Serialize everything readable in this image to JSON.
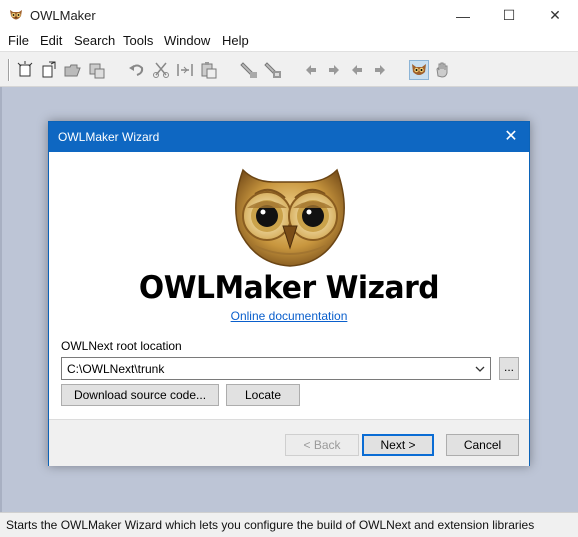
{
  "app": {
    "title": "OWLMaker",
    "window_controls": {
      "minimize": "—",
      "maximize": "☐",
      "close": "✕"
    }
  },
  "menu": [
    "File",
    "Edit",
    "Search",
    "Tools",
    "Window",
    "Help"
  ],
  "toolbar": {
    "groups": [
      [
        "new-wizard-icon",
        "new-file-icon",
        "open-folder-icon",
        "save-icon"
      ],
      [
        "undo-icon",
        "cut-icon",
        "split-icon",
        "paste-icon"
      ],
      [
        "build-icon",
        "build-all-icon"
      ],
      [
        "arrow-left-icon",
        "arrow-right-icon",
        "arrow-left-alt-icon",
        "arrow-right-alt-icon"
      ],
      [
        "owl-icon",
        "hand-icon"
      ]
    ]
  },
  "dialog": {
    "title": "OWLMaker Wizard",
    "close": "✕",
    "heading": "OWLMaker Wizard",
    "doc_link": "Online documentation",
    "root_label": "OWLNext root location",
    "root_value": "C:\\OWLNext\\trunk",
    "browse": "...",
    "download_button": "Download source code...",
    "locate_button": "Locate",
    "back_button": "< Back",
    "next_button": "Next >",
    "cancel_button": "Cancel"
  },
  "status": "Starts the OWLMaker Wizard which lets you configure the build of OWLNext and extension libraries",
  "colors": {
    "dialog_title": "#0e67c2",
    "client_bg": "#bdc5d6",
    "link": "#0a5fcc",
    "focus": "#0a6cd4"
  }
}
